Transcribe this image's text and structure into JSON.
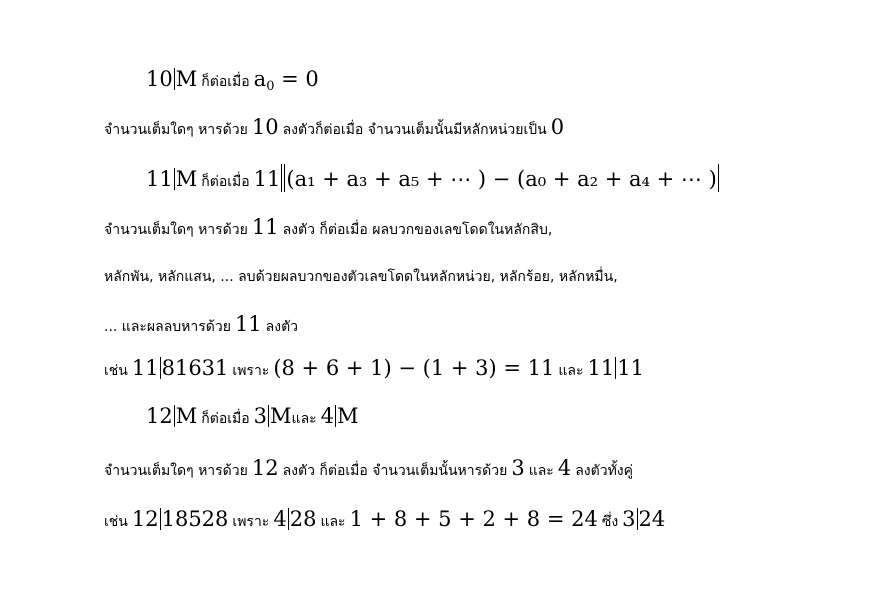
{
  "rules": [
    {
      "title_a": "10",
      "title_b": "M",
      "title_th": "ก็ต่อเมื่อ",
      "title_c": "a",
      "title_sub": "0",
      "title_d": " = 0",
      "desc": [
        {
          "a": "จำนวนเต็มใดๆ หารด้วย",
          "b": "10",
          "c": "ลงตัวก็ต่อเมื่อ จำนวนเต็มนั้นมีหลักหน่วยเป็น",
          "d": "0"
        }
      ]
    },
    {
      "title_a": "11",
      "title_b": "M",
      "title_th": "ก็ต่อเมื่อ",
      "title_c": "11",
      "title_expr": "(a₁ + a₃ + a₅ + ⋯ ) − (a₀ + a₂ + a₄ + ⋯ )",
      "desc": [
        {
          "a": "จำนวนเต็มใดๆ หารด้วย",
          "b": "11",
          "c": "ลงตัว ก็ต่อเมื่อ ผลบวกของเลขโดดในหลักสิบ,"
        },
        {
          "a": "หลักพัน, หลักแสน, ... ลบด้วยผลบวกของตัวเลขโดดในหลักหน่วย, หลักร้อย, หลักหมื่น,"
        },
        {
          "a": "... และผลลบหารด้วย",
          "b": "11",
          "c": "ลงตัว"
        }
      ],
      "example": {
        "a": "เช่น",
        "b": "11",
        "c": "81631",
        "d": "เพราะ",
        "e": "(8 + 6 + 1) − (1 + 3) = 11",
        "f": "และ",
        "g": "11",
        "h": "11"
      }
    },
    {
      "title_a": "12",
      "title_b": "M",
      "title_th": "ก็ต่อเมื่อ",
      "title_c": "3",
      "title_d": "M",
      "title_th2": "และ",
      "title_e": "4",
      "title_f": "M",
      "desc": [
        {
          "a": "จำนวนเต็มใดๆ หารด้วย",
          "b": "12",
          "c": "ลงตัว ก็ต่อเมื่อ จำนวนเต็มนั้นหารด้วย",
          "d": "3",
          "e": "และ",
          "f": "4",
          "g": "ลงตัวทั้งคู่"
        }
      ],
      "example": {
        "a": "เช่น",
        "b": "12",
        "c": "18528",
        "d": "เพราะ",
        "e": "4",
        "f": "28",
        "g": "และ",
        "h": "1 + 8 + 5 + 2 + 8 = 24",
        "i": "ซึ่ง",
        "j": "3",
        "k": "24"
      }
    }
  ]
}
